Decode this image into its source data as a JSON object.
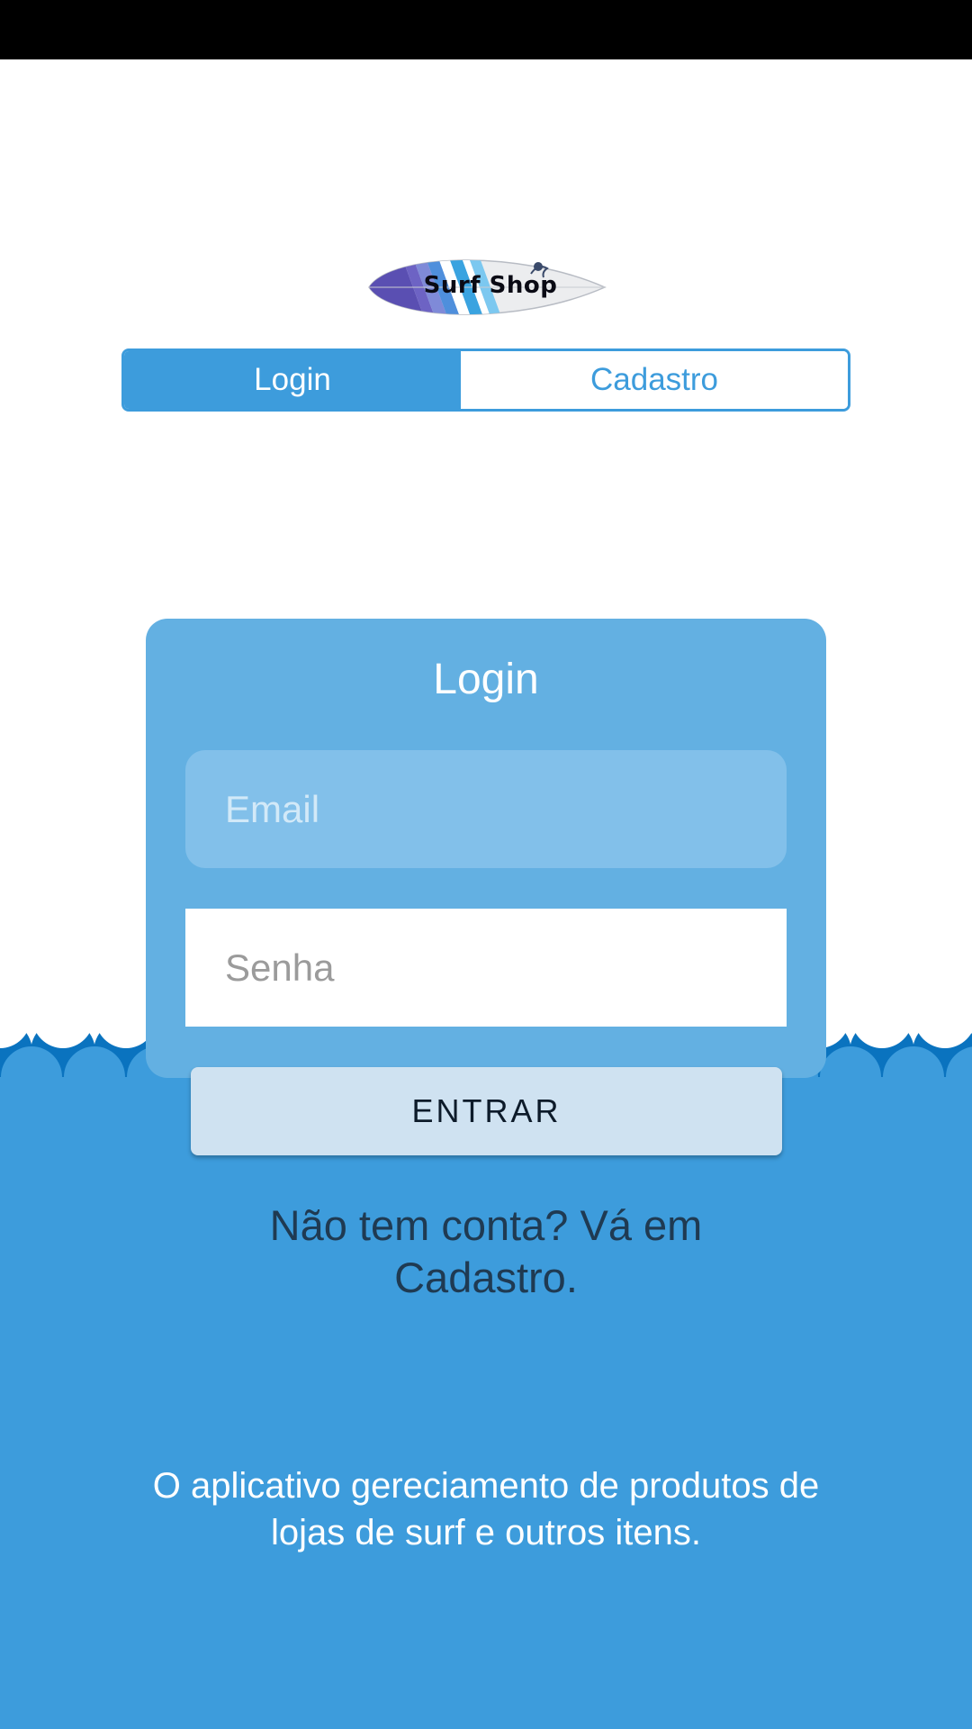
{
  "logo": {
    "text": "Surf Shop"
  },
  "tabs": [
    {
      "label": "Login",
      "active": true
    },
    {
      "label": "Cadastro",
      "active": false
    }
  ],
  "login_card": {
    "title": "Login",
    "email_placeholder": "Email",
    "email_value": "",
    "password_placeholder": "Senha",
    "password_value": "",
    "submit_label": "ENTRAR"
  },
  "signup_hint": "Não tem conta? Vá em Cadastro.",
  "description": "O aplicativo gereciamento de produtos de lojas de surf e outros itens.",
  "colors": {
    "primary": "#3d9cdc",
    "card": "#63b0e2",
    "email_field": "#82c0ea",
    "button": "#cfe2f1",
    "wave_dark": "#0a73bf"
  }
}
